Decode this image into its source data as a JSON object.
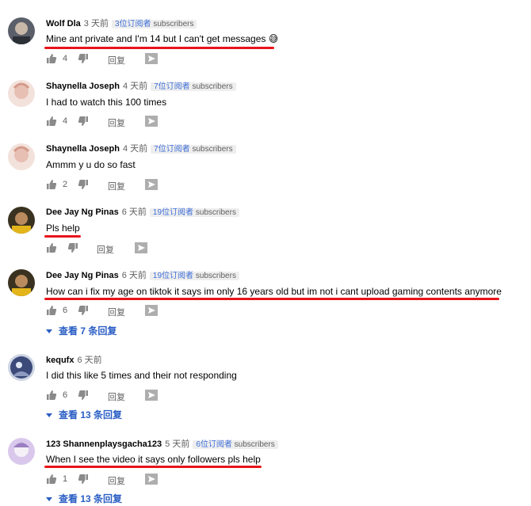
{
  "comments": [
    {
      "author": "Wolf Dla",
      "time": "3 天前",
      "subs_count": "3位订阅者",
      "subs_label": "subscribers",
      "text": "Mine ant private and I'm 14 but I can't get messages 😅",
      "likes": "4",
      "reply_label": "回复",
      "underline": true
    },
    {
      "author": "Shaynella Joseph",
      "time": "4 天前",
      "subs_count": "7位订阅者",
      "subs_label": "subscribers",
      "text": "I had to watch this 100 times",
      "likes": "4",
      "reply_label": "回复",
      "underline": false
    },
    {
      "author": "Shaynella Joseph",
      "time": "4 天前",
      "subs_count": "7位订阅者",
      "subs_label": "subscribers",
      "text": "Ammm y u do so fast",
      "likes": "2",
      "reply_label": "回复",
      "underline": false
    },
    {
      "author": "Dee Jay Ng Pinas",
      "time": "6 天前",
      "subs_count": "19位订阅者",
      "subs_label": "subscribers",
      "text": "Pls help",
      "likes": "",
      "reply_label": "回复",
      "underline": true
    },
    {
      "author": "Dee Jay Ng Pinas",
      "time": "6 天前",
      "subs_count": "19位订阅者",
      "subs_label": "subscribers",
      "text": "How can i fix my age on tiktok it says im only 16 years old but im not i cant upload gaming contents anymore",
      "likes": "6",
      "reply_label": "回复",
      "replies": "查看 7 条回复",
      "underline": true
    },
    {
      "author": "kequfx",
      "time": "6 天前",
      "subs_count": "",
      "subs_label": "",
      "text": "I did this like 5 times and their not responding",
      "likes": "6",
      "reply_label": "回复",
      "replies": "查看 13 条回复",
      "underline": false
    },
    {
      "author": "123 Shannenplaysgacha123",
      "time": "5 天前",
      "subs_count": "6位订阅者",
      "subs_label": "subscribers",
      "text": "When I see the video it says only followers pls help",
      "likes": "1",
      "reply_label": "回复",
      "replies": "查看 13 条回复",
      "underline": true
    }
  ],
  "colors": {
    "underline": "#e8141a",
    "link": "#2a5ec4",
    "meta": "#606060"
  }
}
